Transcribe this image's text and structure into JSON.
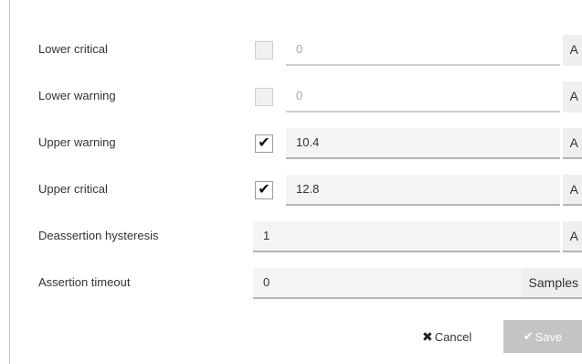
{
  "rows": [
    {
      "label": "Lower critical",
      "checked": false,
      "value": "0",
      "unit": "A"
    },
    {
      "label": "Lower warning",
      "checked": false,
      "value": "0",
      "unit": "A"
    },
    {
      "label": "Upper warning",
      "checked": true,
      "value": "10.4",
      "unit": "A"
    },
    {
      "label": "Upper critical",
      "checked": true,
      "value": "12.8",
      "unit": "A"
    },
    {
      "label": "Deassertion hysteresis",
      "value": "1",
      "unit": "A"
    },
    {
      "label": "Assertion timeout",
      "value": "0",
      "unit": "Samples"
    }
  ],
  "actions": {
    "cancel_icon": "✖",
    "cancel_label": "Cancel",
    "save_icon": "✔",
    "save_label": "Save"
  },
  "icons": {
    "checkmark": "check-icon",
    "cancel": "close-icon"
  },
  "colors": {
    "save_disabled": "#c4c4c4",
    "field_background": "#f4f4f4"
  }
}
